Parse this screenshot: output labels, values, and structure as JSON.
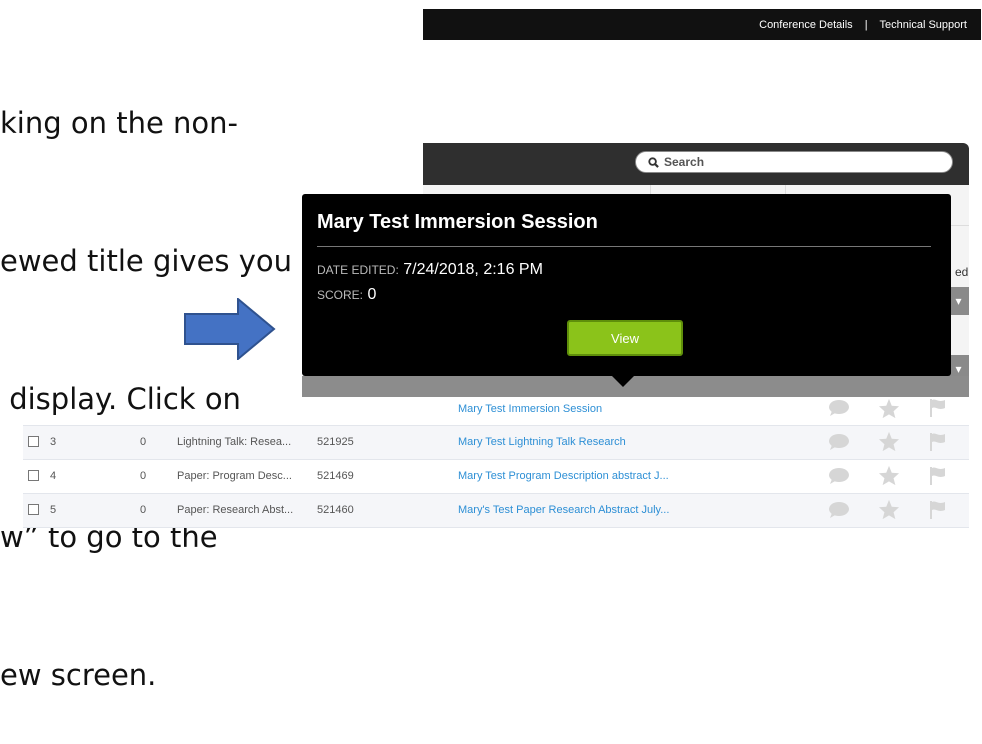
{
  "instruction": {
    "lines": [
      "king on the non-",
      "ewed title gives you",
      " display. Click on",
      "w” to go to the",
      "ew screen."
    ]
  },
  "topnav": {
    "conference_details": "Conference Details",
    "separator": "|",
    "technical_support": "Technical Support"
  },
  "search": {
    "label": "Search"
  },
  "partial_column_text": "ed",
  "tooltip": {
    "title": "Mary Test Immersion Session",
    "date_label": "DATE EDITED:",
    "date_value": "7/24/2018, 2:16 PM",
    "score_label": "SCORE:",
    "score_value": "0",
    "view_button": "View"
  },
  "arrow": {
    "color": "#4472c4",
    "icon": "right-arrow-icon"
  },
  "colors": {
    "view_button": "#8bc31a",
    "link": "#2d8fd5",
    "tooltip_bg": "#000000",
    "header_bg": "#2f2f2f"
  },
  "table": {
    "partial_row": {
      "title": "Mary Test Immersion Session"
    },
    "rows": [
      {
        "num": "3",
        "score": "0",
        "type": "Lightning Talk: Resea...",
        "id": "521925",
        "title": "Mary Test Lightning Talk Research"
      },
      {
        "num": "4",
        "score": "0",
        "type": "Paper: Program Desc...",
        "id": "521469",
        "title": "Mary Test Program Description abstract J..."
      },
      {
        "num": "5",
        "score": "0",
        "type": "Paper: Research Abst...",
        "id": "521460",
        "title": "Mary's Test Paper Research Abstract July..."
      }
    ],
    "row_icons": [
      "comment-icon",
      "star-icon",
      "flag-icon"
    ]
  }
}
